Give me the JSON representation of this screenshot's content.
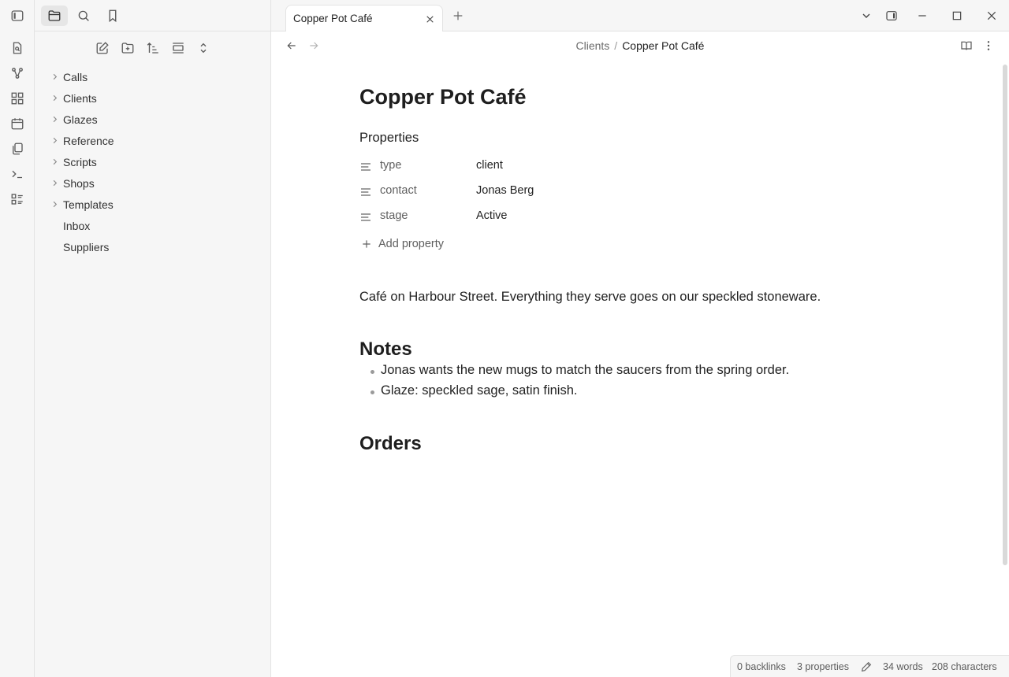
{
  "tab": {
    "title": "Copper Pot Café"
  },
  "breadcrumb": {
    "parent": "Clients",
    "separator": "/",
    "current": "Copper Pot Café"
  },
  "sidebar": {
    "folders": [
      {
        "label": "Calls"
      },
      {
        "label": "Clients"
      },
      {
        "label": "Glazes"
      },
      {
        "label": "Reference"
      },
      {
        "label": "Scripts"
      },
      {
        "label": "Shops"
      },
      {
        "label": "Templates"
      }
    ],
    "files": [
      {
        "label": "Inbox"
      },
      {
        "label": "Suppliers"
      }
    ]
  },
  "note": {
    "title": "Copper Pot Café",
    "properties_heading": "Properties",
    "properties": [
      {
        "key": "type",
        "value": "client"
      },
      {
        "key": "contact",
        "value": "Jonas Berg"
      },
      {
        "key": "stage",
        "value": "Active"
      }
    ],
    "add_property": "Add property",
    "body": "Café on Harbour Street. Everything they serve goes on our speckled stoneware.",
    "notes_heading": "Notes",
    "notes_items": [
      "Jonas wants the new mugs to match the saucers from the spring order.",
      "Glaze: speckled sage, satin finish."
    ],
    "orders_heading": "Orders"
  },
  "status": {
    "backlinks": "0 backlinks",
    "properties": "3 properties",
    "words": "34 words",
    "characters": "208 characters"
  },
  "icons": {
    "ribbon": [
      "open-quick-switcher-icon",
      "graph-view-icon",
      "canvas-icon",
      "daily-note-icon",
      "templates-icon",
      "command-palette-icon",
      "bases-icon"
    ],
    "sidebar_tabs": [
      "file-explorer-icon",
      "search-icon",
      "bookmarks-icon"
    ],
    "nav_actions": [
      "new-note-icon",
      "new-folder-icon",
      "sort-icon",
      "auto-reveal-icon",
      "collapse-all-icon"
    ]
  },
  "colors": {
    "sidebar_bg": "#f6f6f6",
    "border": "#e3e3e3",
    "text": "#222222",
    "muted": "#5f5f5f"
  }
}
